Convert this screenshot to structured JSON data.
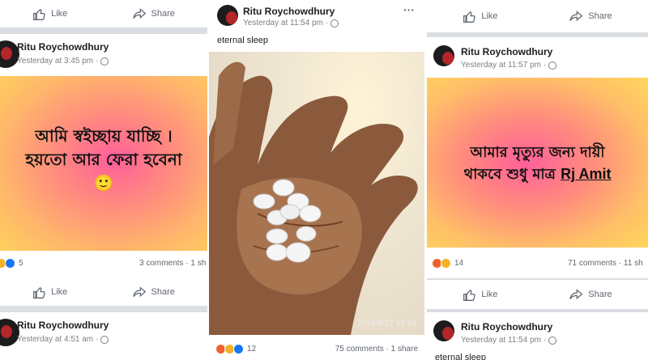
{
  "panel_left": {
    "top_actions": {
      "like": "Like",
      "share": "Share"
    },
    "post1": {
      "author": "Ritu Roychowdhury",
      "time": "Yesterday at 3:45 pm",
      "text_line1": "আমি স্বইচ্ছায় যাচ্ছি ।",
      "text_line2": "হয়তো আর ফেরা হবেনা",
      "emoji": "🙂",
      "reaction_count": "5",
      "comments": "3 comments · 1 sh",
      "actions": {
        "like": "Like",
        "share": "Share"
      }
    },
    "post2": {
      "author": "Ritu Roychowdhury",
      "time": "Yesterday at 4:51 am"
    }
  },
  "panel_middle": {
    "author": "Ritu Roychowdhury",
    "time": "Yesterday at 11:54 pm ·",
    "more": "···",
    "caption": "eternal sleep",
    "photo_timestamp": "2019/8/27  23:52",
    "reaction_count": "12",
    "comments": "75 comments · 1 share"
  },
  "panel_right": {
    "top_actions": {
      "like": "Like",
      "share": "Share"
    },
    "post1": {
      "author": "Ritu Roychowdhury",
      "time": "Yesterday at 11:57 pm ·",
      "text_line1": "আমার মৃত্যুর জন্য দায়ী",
      "text_line2_prefix": "থাকবে শুধু মাত্র",
      "text_line2_tag": "Rj Amit",
      "reaction_count": "14",
      "comments": "71 comments · 11 sh",
      "actions": {
        "like": "Like",
        "share": "Share"
      }
    },
    "post2": {
      "author": "Ritu Roychowdhury",
      "time": "Yesterday at 11:54 pm ·",
      "caption_partial": "eternal sleep"
    }
  },
  "colors": {
    "like_blue": "#1877f2",
    "angry": "#f0622d",
    "haha": "#f7b125",
    "background_gray": "#dadde1"
  }
}
